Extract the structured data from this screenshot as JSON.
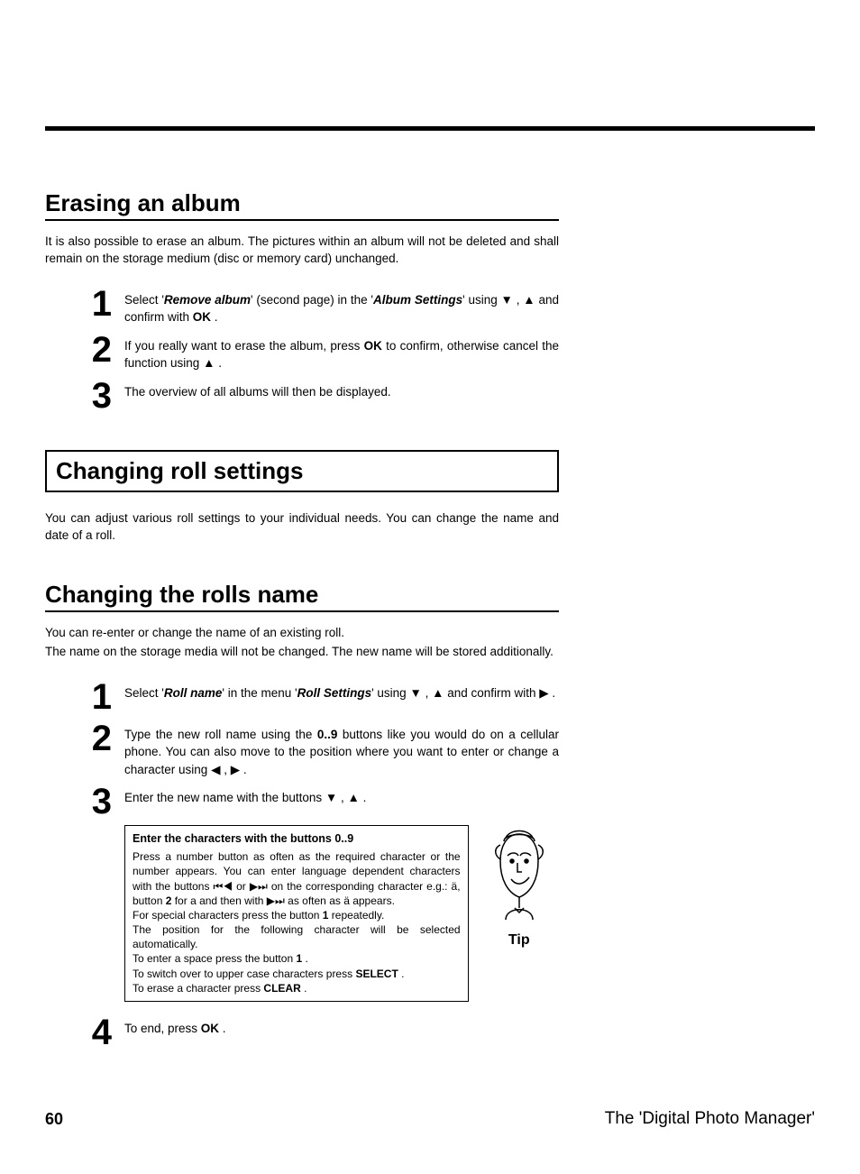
{
  "sectionA": {
    "title": "Erasing an album",
    "intro": "It is also possible to erase an album. The pictures within an album will not be deleted and shall remain on the storage medium (disc or memory card) unchanged.",
    "steps": {
      "s1_pre": "Select '",
      "s1_b1": "Remove album",
      "s1_mid": "' (second page) in the '",
      "s1_b2": "Album Settings",
      "s1_post1": "' using ",
      "s1_post2": " , ",
      "s1_post3": " and confirm with ",
      "s1_ok": "OK",
      "s1_end": " .",
      "s2_pre": "If you really want to erase the album, press ",
      "s2_ok": "OK",
      "s2_mid": " to confirm, otherwise cancel the function using ",
      "s2_end": " .",
      "s3": "The overview of all albums will then be displayed."
    }
  },
  "sectionB": {
    "title": "Changing roll settings",
    "intro": "You can adjust various roll settings to your individual needs. You can change the name and date of a roll."
  },
  "sectionC": {
    "title": "Changing the rolls name",
    "intro1": "You can re-enter or change the name of an existing roll.",
    "intro2": "The name on the storage media will not be changed. The new name will be stored additionally.",
    "steps": {
      "s1_pre": "Select '",
      "s1_b1": "Roll name",
      "s1_mid": "' in the menu '",
      "s1_b2": "Roll Settings",
      "s1_post1": "' using ",
      "s1_post2": " , ",
      "s1_post3": " and confirm with ",
      "s1_end": " .",
      "s2_pre": "Type the new roll name using the ",
      "s2_b": "0..9",
      "s2_mid": " buttons like you would do on a cellular phone. You can also move to the position where you want to enter or change a character using ",
      "s2_end": " .",
      "s3_pre": "Enter the new name with the buttons ",
      "s3_end": " .",
      "s4_pre": "To end, press ",
      "s4_ok": "OK",
      "s4_end": " ."
    },
    "tip": {
      "header": "Enter the characters with the buttons  0..9",
      "l1a": "Press a number button as often as the required character or the number appears. You can enter language dependent characters with the buttons ",
      "l1b": " or ",
      "l1c": " on the corresponding character e.g.: ä, button ",
      "l1d": "2",
      "l1e": " for a and then with ",
      "l1f": " as often as ä appears.",
      "l2a": "For special characters press the button ",
      "l2b": "1",
      "l2c": " repeatedly.",
      "l3": "The position for the following character will be selected automatically.",
      "l4a": "To enter a space press the button ",
      "l4b": "1",
      "l4c": " .",
      "l5a": "To switch over to upper case characters press ",
      "l5b": "SELECT",
      "l5c": " .",
      "l6a": "To erase a character press ",
      "l6b": "CLEAR",
      "l6c": " .",
      "label": "Tip"
    }
  },
  "footer": {
    "page": "60",
    "title": "The 'Digital Photo Manager'"
  },
  "glyphs": {
    "down": "▼",
    "up": "▲",
    "left": "◀",
    "right": "▶",
    "prev": "⏮◀",
    "next": "▶⏭"
  }
}
